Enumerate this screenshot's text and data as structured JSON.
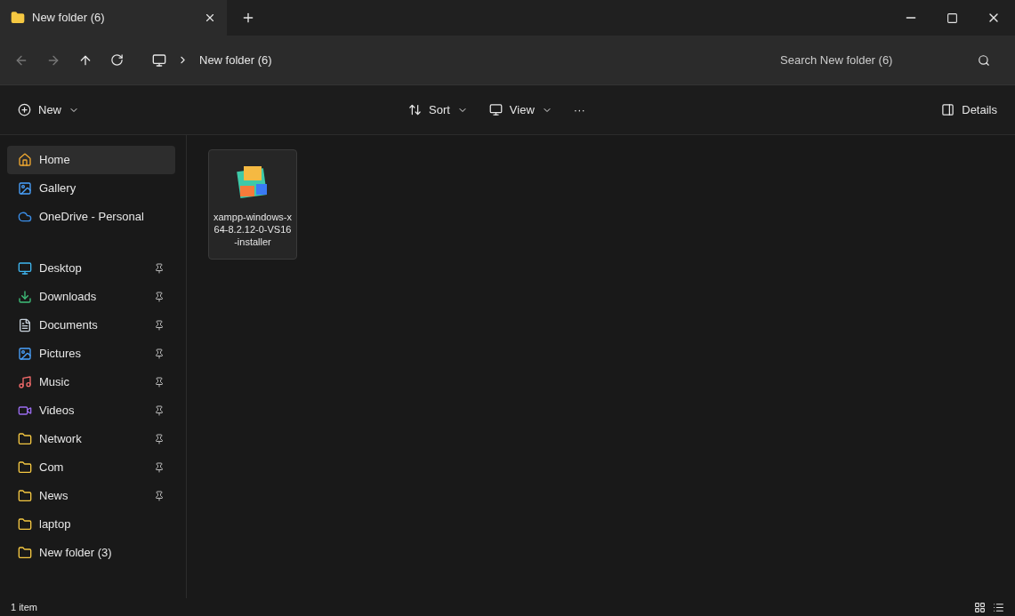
{
  "window": {
    "title": "New folder (6)"
  },
  "address_bar": {
    "breadcrumb": "New folder (6)",
    "search": {
      "placeholder": "Search New folder (6)"
    }
  },
  "command_bar": {
    "new": "New",
    "sort": "Sort",
    "view": "View",
    "more": "···",
    "details": "Details"
  },
  "sidebar": {
    "items": [
      {
        "label": "Home",
        "kind": "home",
        "selected": true,
        "pinned": false
      },
      {
        "label": "Gallery",
        "kind": "gallery",
        "selected": false,
        "pinned": false
      },
      {
        "label": "OneDrive - Personal",
        "kind": "cloud",
        "selected": false,
        "pinned": false
      },
      {
        "label": "Desktop",
        "kind": "desktop",
        "selected": false,
        "pinned": true
      },
      {
        "label": "Downloads",
        "kind": "download",
        "selected": false,
        "pinned": true
      },
      {
        "label": "Documents",
        "kind": "document",
        "selected": false,
        "pinned": true
      },
      {
        "label": "Pictures",
        "kind": "picture",
        "selected": false,
        "pinned": true
      },
      {
        "label": "Music",
        "kind": "music",
        "selected": false,
        "pinned": true
      },
      {
        "label": "Videos",
        "kind": "video",
        "selected": false,
        "pinned": true
      },
      {
        "label": "Network",
        "kind": "folder",
        "selected": false,
        "pinned": true
      },
      {
        "label": "Com",
        "kind": "folder",
        "selected": false,
        "pinned": true
      },
      {
        "label": "News",
        "kind": "folder",
        "selected": false,
        "pinned": true
      },
      {
        "label": "laptop",
        "kind": "folder",
        "selected": false,
        "pinned": false
      },
      {
        "label": "New folder (3)",
        "kind": "folder",
        "selected": false,
        "pinned": false
      }
    ]
  },
  "files": [
    {
      "name": "xampp-windows-x64-8.2.12-0-VS16-installer",
      "selected": true
    }
  ],
  "status_bar": {
    "count": "1 item"
  }
}
